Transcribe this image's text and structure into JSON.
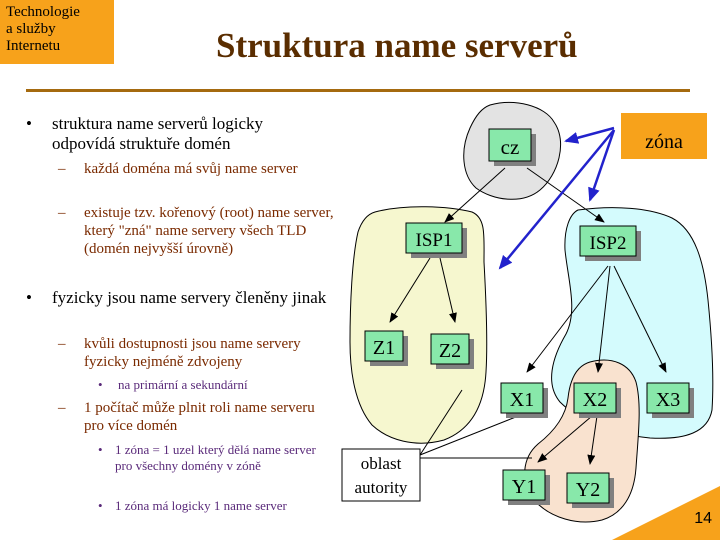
{
  "header": {
    "corner_lines": [
      "Technologie",
      "a služby",
      "Internetu"
    ],
    "title": "Struktura name serverů"
  },
  "bullets": {
    "b1": "struktura name serverů logicky odpovídá struktuře domén",
    "b1_sub1": "každá doména má svůj name server",
    "b1_sub2": "existuje tzv. kořenový (root) name server, který \"zná\" name servery všech TLD (domén nejvyšší úrovně)",
    "b2": "fyzicky jsou name servery členěny jinak",
    "b2_sub1": "kvůli dostupnosti jsou name servery fyzicky nejméně zdvojeny",
    "b2_sub1_item": "na primární a sekundární",
    "b2_sub2": "1 počítač může plnit roli name serveru pro více domén",
    "b2_sub2_item1": "1 zóna = 1 uzel který dělá name server pro všechny domény v zóně",
    "b2_sub2_item2": "1 zóna má logicky 1 name server"
  },
  "diagram": {
    "nodes": {
      "cz": "cz",
      "isp1": "ISP1",
      "isp2": "ISP2",
      "z1": "Z1",
      "z2": "Z2",
      "x1": "X1",
      "x2": "X2",
      "x3": "X3",
      "y1": "Y1",
      "y2": "Y2"
    },
    "zone_label": "zóna",
    "authority_label": [
      "oblast",
      "autority"
    ]
  },
  "footer": {
    "page_number": "14"
  },
  "colors": {
    "corner": "#f7a21b",
    "title": "#5a2d00",
    "rule": "#a56a0f",
    "node_fill": "#88e8aa",
    "zone_gray": "#e3e3e3",
    "zone_yellow": "#f6f7cf",
    "zone_cyan": "#d4fbfd",
    "zone_peach": "#f9e2cf",
    "pointer_arrow": "#2222cc"
  }
}
